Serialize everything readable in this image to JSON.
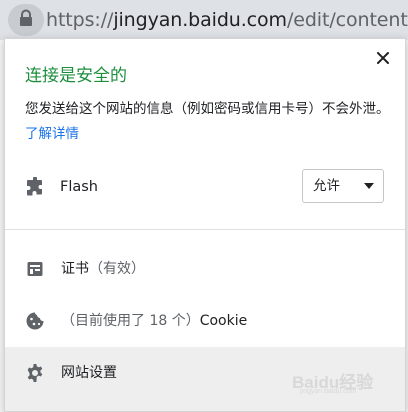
{
  "address_bar": {
    "url_prefix": "https://",
    "url_host": "jingyan.baidu.com",
    "url_path": "/edit/content",
    "lock_icon": "lock-icon"
  },
  "popup": {
    "title": "连接是安全的",
    "description": "您发送给这个网站的信息（例如密码或信用卡号）不会外泄。",
    "learn_more": "了解详情",
    "close_icon": "close-icon",
    "permission": {
      "icon": "puzzle-icon",
      "label": "Flash",
      "selected_option": "允许"
    },
    "items": [
      {
        "icon": "certificate-icon",
        "label": "证书",
        "suffix": "（有效）"
      },
      {
        "icon": "cookie-icon",
        "prefix": "（目前使用了 18 个）",
        "label": "Cookie"
      },
      {
        "icon": "gear-icon",
        "label": "网站设置"
      }
    ]
  },
  "watermark": {
    "text": "Baidu经验",
    "sub": "jingyan.baidu.com"
  },
  "colors": {
    "secure_green": "#1e8e3e",
    "link_blue": "#1a73e8",
    "address_bar_bg": "#dee1e6"
  }
}
